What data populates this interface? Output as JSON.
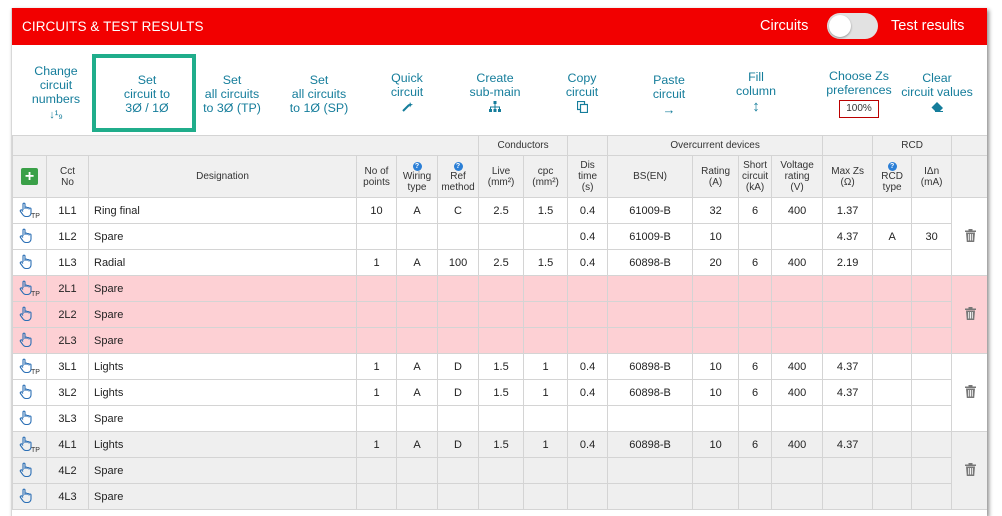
{
  "header": {
    "title": "CIRCUITS & TEST RESULTS",
    "toggle_left": "Circuits",
    "toggle_right": "Test results"
  },
  "toolbar": {
    "change_numbers": [
      "Change",
      "circuit",
      "numbers"
    ],
    "change_numbers_icon": "↓¹₉",
    "set_circuit": [
      "Set",
      "circuit to",
      "3Ø / 1Ø"
    ],
    "set_all_tp": [
      "Set",
      "all circuits",
      "to 3Ø (TP)"
    ],
    "set_all_sp": [
      "Set",
      "all circuits",
      "to 1Ø (SP)"
    ],
    "quick_circuit": [
      "Quick",
      "circuit"
    ],
    "create_submain": [
      "Create",
      "sub-main"
    ],
    "copy_circuit": [
      "Copy",
      "circuit"
    ],
    "paste_circuit": [
      "Paste",
      "circuit"
    ],
    "paste_icon": "→",
    "fill_column": [
      "Fill",
      "column"
    ],
    "fill_icon": "↕",
    "choose_zs": [
      "Choose Zs",
      "preferences"
    ],
    "zs_badge": "100%",
    "clear_values": [
      "Clear",
      "circuit values"
    ]
  },
  "table": {
    "group_headers": {
      "conductors": "Conductors",
      "overcurrent": "Overcurrent devices",
      "rcd": "RCD"
    },
    "columns": {
      "cct_no": [
        "Cct",
        "No"
      ],
      "designation": "Designation",
      "no_points": [
        "No of",
        "points"
      ],
      "wiring_type": [
        "Wiring",
        "type"
      ],
      "ref_method": [
        "Ref",
        "method"
      ],
      "live": [
        "Live",
        "(mm²)"
      ],
      "cpc": [
        "cpc",
        "(mm²)"
      ],
      "dis_time": [
        "Dis",
        "time",
        "(s)"
      ],
      "bs_en": "BS(EN)",
      "rating": [
        "Rating",
        "(A)"
      ],
      "short_circuit": [
        "Short",
        "circuit",
        "(kA)"
      ],
      "voltage_rating": [
        "Voltage",
        "rating",
        "(V)"
      ],
      "max_zs": [
        "Max Zs",
        "(Ω)"
      ],
      "rcd_type": [
        "RCD",
        "type"
      ],
      "idn": [
        "IΔn",
        "(mA)"
      ]
    },
    "tp_label": "TP",
    "rows": [
      {
        "cct": "1L1",
        "tp": true,
        "desig": "Ring final",
        "points": "10",
        "wiring": "A",
        "ref": "C",
        "live": "2.5",
        "cpc": "1.5",
        "dis": "0.4",
        "bs": "61009-B",
        "rating": "32",
        "sc": "6",
        "volt": "400",
        "zs": "1.37",
        "rcdtype": "",
        "idn": ""
      },
      {
        "cct": "1L2",
        "tp": false,
        "desig": "Spare",
        "points": "",
        "wiring": "",
        "ref": "",
        "live": "",
        "cpc": "",
        "dis": "0.4",
        "bs": "61009-B",
        "rating": "10",
        "sc": "",
        "volt": "",
        "zs": "4.37",
        "rcdtype": "A",
        "idn": "30"
      },
      {
        "cct": "1L3",
        "tp": false,
        "desig": "Radial",
        "points": "1",
        "wiring": "A",
        "ref": "100",
        "live": "2.5",
        "cpc": "1.5",
        "dis": "0.4",
        "bs": "60898-B",
        "rating": "20",
        "sc": "6",
        "volt": "400",
        "zs": "2.19",
        "rcdtype": "",
        "idn": ""
      },
      {
        "cct": "2L1",
        "tp": true,
        "desig": "Spare",
        "points": "",
        "wiring": "",
        "ref": "",
        "live": "",
        "cpc": "",
        "dis": "",
        "bs": "",
        "rating": "",
        "sc": "",
        "volt": "",
        "zs": "",
        "rcdtype": "",
        "idn": ""
      },
      {
        "cct": "2L2",
        "tp": false,
        "desig": "Spare",
        "points": "",
        "wiring": "",
        "ref": "",
        "live": "",
        "cpc": "",
        "dis": "",
        "bs": "",
        "rating": "",
        "sc": "",
        "volt": "",
        "zs": "",
        "rcdtype": "",
        "idn": ""
      },
      {
        "cct": "2L3",
        "tp": false,
        "desig": "Spare",
        "points": "",
        "wiring": "",
        "ref": "",
        "live": "",
        "cpc": "",
        "dis": "",
        "bs": "",
        "rating": "",
        "sc": "",
        "volt": "",
        "zs": "",
        "rcdtype": "",
        "idn": ""
      },
      {
        "cct": "3L1",
        "tp": true,
        "desig": "Lights",
        "points": "1",
        "wiring": "A",
        "ref": "D",
        "live": "1.5",
        "cpc": "1",
        "dis": "0.4",
        "bs": "60898-B",
        "rating": "10",
        "sc": "6",
        "volt": "400",
        "zs": "4.37",
        "rcdtype": "",
        "idn": ""
      },
      {
        "cct": "3L2",
        "tp": false,
        "desig": "Lights",
        "points": "1",
        "wiring": "A",
        "ref": "D",
        "live": "1.5",
        "cpc": "1",
        "dis": "0.4",
        "bs": "60898-B",
        "rating": "10",
        "sc": "6",
        "volt": "400",
        "zs": "4.37",
        "rcdtype": "",
        "idn": ""
      },
      {
        "cct": "3L3",
        "tp": false,
        "desig": "Spare",
        "points": "",
        "wiring": "",
        "ref": "",
        "live": "",
        "cpc": "",
        "dis": "",
        "bs": "",
        "rating": "",
        "sc": "",
        "volt": "",
        "zs": "",
        "rcdtype": "",
        "idn": ""
      },
      {
        "cct": "4L1",
        "tp": true,
        "desig": "Lights",
        "points": "1",
        "wiring": "A",
        "ref": "D",
        "live": "1.5",
        "cpc": "1",
        "dis": "0.4",
        "bs": "60898-B",
        "rating": "10",
        "sc": "6",
        "volt": "400",
        "zs": "4.37",
        "rcdtype": "",
        "idn": ""
      },
      {
        "cct": "4L2",
        "tp": false,
        "desig": "Spare",
        "points": "",
        "wiring": "",
        "ref": "",
        "live": "",
        "cpc": "",
        "dis": "",
        "bs": "",
        "rating": "",
        "sc": "",
        "volt": "",
        "zs": "",
        "rcdtype": "",
        "idn": ""
      },
      {
        "cct": "4L3",
        "tp": false,
        "desig": "Spare",
        "points": "",
        "wiring": "",
        "ref": "",
        "live": "",
        "cpc": "",
        "dis": "",
        "bs": "",
        "rating": "",
        "sc": "",
        "volt": "",
        "zs": "",
        "rcdtype": "",
        "idn": ""
      }
    ]
  },
  "colors": {
    "header_red": "#f20000",
    "link_teal": "#157d9b",
    "highlight_green": "#20ad8b",
    "row_pink": "#fdd0d4",
    "row_gray": "#efefef"
  }
}
